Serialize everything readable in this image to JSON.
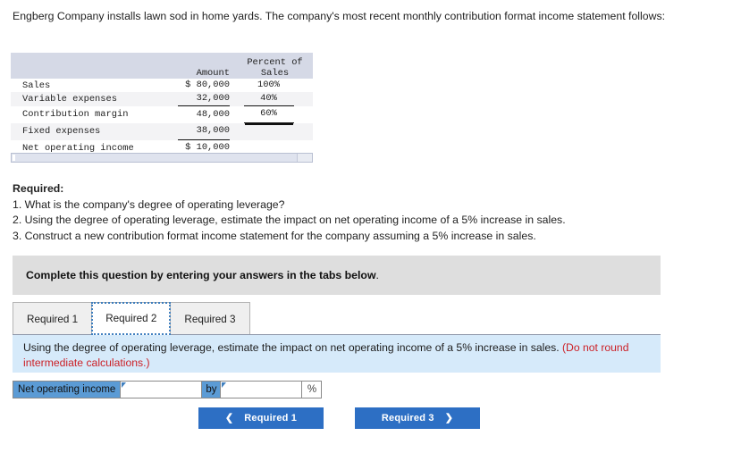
{
  "intro": "Engberg Company installs lawn sod in home yards. The company's most recent monthly contribution format income statement follows:",
  "statement": {
    "headers": {
      "blank": "",
      "amount": "Amount",
      "percent_line1": "Percent of",
      "percent_line2": "Sales"
    },
    "rows": [
      {
        "label": "Sales",
        "amount": "$ 80,000",
        "percent": "100%"
      },
      {
        "label": "Variable expenses",
        "amount": "32,000",
        "percent": "40%"
      },
      {
        "label": "Contribution margin",
        "amount": "48,000",
        "percent": "60%"
      },
      {
        "label": "Fixed expenses",
        "amount": "38,000",
        "percent": ""
      },
      {
        "label": "Net operating income",
        "amount": "$ 10,000",
        "percent": ""
      }
    ]
  },
  "required": {
    "heading": "Required:",
    "items": [
      "1. What is the company's degree of operating leverage?",
      "2. Using the degree of operating leverage, estimate the impact on net operating income of a 5% increase in sales.",
      "3. Construct a new contribution format income statement for the company assuming a 5% increase in sales."
    ]
  },
  "banner": {
    "bold_text": "Complete this question by entering your answers in the tabs below",
    "tail": "."
  },
  "tabs": [
    {
      "label": "Required 1",
      "active": false
    },
    {
      "label": "Required 2",
      "active": true
    },
    {
      "label": "Required 3",
      "active": false
    }
  ],
  "prompt": {
    "main": "Using the degree of operating leverage, estimate the impact on net operating income of a 5% increase in sales. ",
    "note": "(Do not round intermediate calculations.)"
  },
  "answer_row": {
    "label": "Net operating income",
    "value1": "",
    "connector": "by",
    "value2": "",
    "unit": "%"
  },
  "nav": {
    "prev_label": "Required 1",
    "prev_icon": "chevron-left-icon",
    "next_label": "Required 3",
    "next_icon": "chevron-right-icon"
  },
  "colors": {
    "table_header_bg": "#d5d9e6",
    "banner_bg": "#dedede",
    "prompt_bg": "#d6eafa",
    "note_red": "#cc2127",
    "cell_blue": "#5b9bd5",
    "button_blue": "#2d6fc4"
  }
}
